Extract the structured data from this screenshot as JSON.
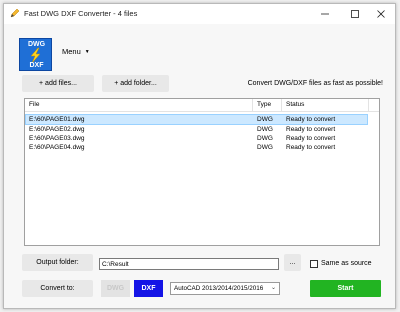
{
  "window": {
    "title": "Fast DWG DXF Converter - 4 files"
  },
  "logo": {
    "top_text": "DWG",
    "bottom_text": "DXF"
  },
  "menu": {
    "label": "Menu"
  },
  "toolbar": {
    "add_files_label": "+ add files...",
    "add_folder_label": "+ add folder...",
    "tagline": "Convert DWG/DXF files as fast as possible!"
  },
  "file_list": {
    "columns": {
      "file": "File",
      "type": "Type",
      "status": "Status"
    },
    "rows": [
      {
        "file": "E:\\60\\PAGE01.dwg",
        "type": "DWG",
        "status": "Ready to convert"
      },
      {
        "file": "E:\\60\\PAGE02.dwg",
        "type": "DWG",
        "status": "Ready to convert"
      },
      {
        "file": "E:\\60\\PAGE03.dwg",
        "type": "DWG",
        "status": "Ready to convert"
      },
      {
        "file": "E:\\60\\PAGE04.dwg",
        "type": "DWG",
        "status": "Ready to convert"
      }
    ]
  },
  "output": {
    "label": "Output folder:",
    "path": "C:\\Result",
    "browse_label": "...",
    "same_as_source_label": "Same as source",
    "same_as_source_checked": false
  },
  "convert": {
    "label": "Convert to:",
    "dwg_label": "DWG",
    "dxf_label": "DXF",
    "version_selected": "AutoCAD 2013/2014/2015/2016",
    "start_label": "Start"
  },
  "colors": {
    "accent_blue": "#1414e6",
    "start_green": "#22b422",
    "selection": "#cce8ff",
    "logo_blue": "#1f6fd6"
  },
  "icons": {
    "app": "pencil-lightning-icon",
    "minimize": "minimize-icon",
    "maximize": "maximize-icon",
    "close": "close-icon"
  }
}
